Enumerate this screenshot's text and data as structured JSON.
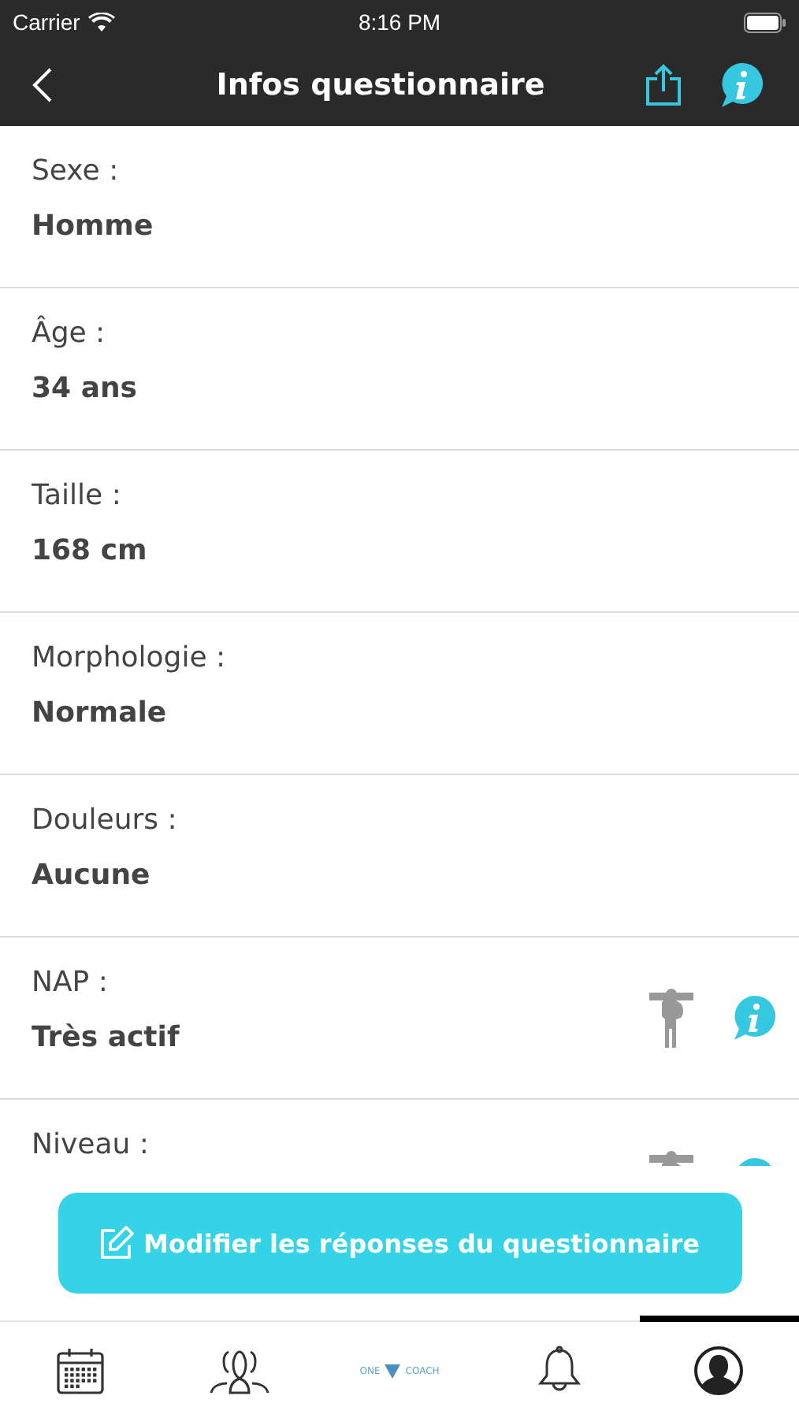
{
  "status_bar": {
    "carrier": "Carrier",
    "time": "8:16 PM"
  },
  "nav": {
    "title": "Infos questionnaire"
  },
  "rows": [
    {
      "label": "Sexe :",
      "value": "Homme",
      "icons": false
    },
    {
      "label": "Âge :",
      "value": "34 ans",
      "icons": false
    },
    {
      "label": "Taille :",
      "value": "168 cm",
      "icons": false
    },
    {
      "label": "Morphologie :",
      "value": "Normale",
      "icons": false
    },
    {
      "label": "Douleurs :",
      "value": "Aucune",
      "icons": false
    },
    {
      "label": "NAP :",
      "value": "Très actif",
      "icons": true
    },
    {
      "label": "Niveau :",
      "icons": true
    }
  ],
  "edit_button": {
    "label": "Modifier les réponses du questionnaire"
  },
  "tabs": [
    {
      "kind": "calendar",
      "selected": false
    },
    {
      "kind": "group",
      "selected": false
    },
    {
      "kind": "logo",
      "left": "ONE",
      "right": "COACH",
      "selected": false
    },
    {
      "kind": "bell",
      "selected": false
    },
    {
      "kind": "profile",
      "selected": true
    }
  ]
}
